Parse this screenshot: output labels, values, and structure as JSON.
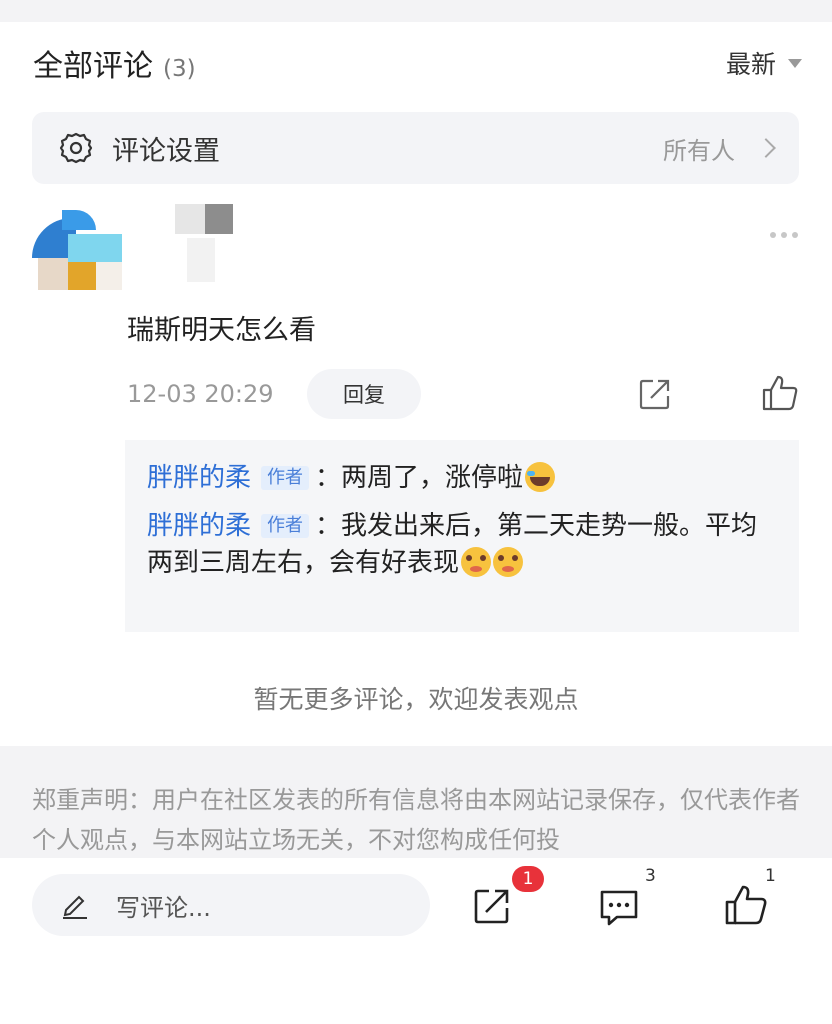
{
  "header": {
    "title": "全部评论",
    "count": "(3)",
    "sort_label": "最新"
  },
  "settings": {
    "label": "评论设置",
    "value": "所有人",
    "icon": "gear-icon"
  },
  "comment": {
    "text": "瑞斯明天怎么看",
    "time": "12-03 20:29",
    "reply_label": "回复"
  },
  "replies": [
    {
      "name": "胖胖的柔",
      "tag": "作者",
      "sep": "：",
      "text": "两周了，涨停啦",
      "emoji": [
        "laugh-cry-emoji"
      ]
    },
    {
      "name": "胖胖的柔",
      "tag": "作者",
      "sep": "：",
      "text": "我发出来后，第二天走势一般。平均两到三周左右，会有好表现",
      "emoji": [
        "flushed-emoji",
        "flushed-emoji"
      ]
    }
  ],
  "no_more_text": "暂无更多评论，欢迎发表观点",
  "disclaimer": "郑重声明：用户在社区发表的所有信息将由本网站记录保存，仅代表作者个人观点，与本网站立场无关，不对您构成任何投",
  "bottom_bar": {
    "input_placeholder": "写评论...",
    "share_badge": "1",
    "comment_count": "3",
    "like_count": "1"
  },
  "colors": {
    "link_blue": "#2e6fd6",
    "badge_red": "#e8323a",
    "panel_bg": "#f3f4f7"
  }
}
